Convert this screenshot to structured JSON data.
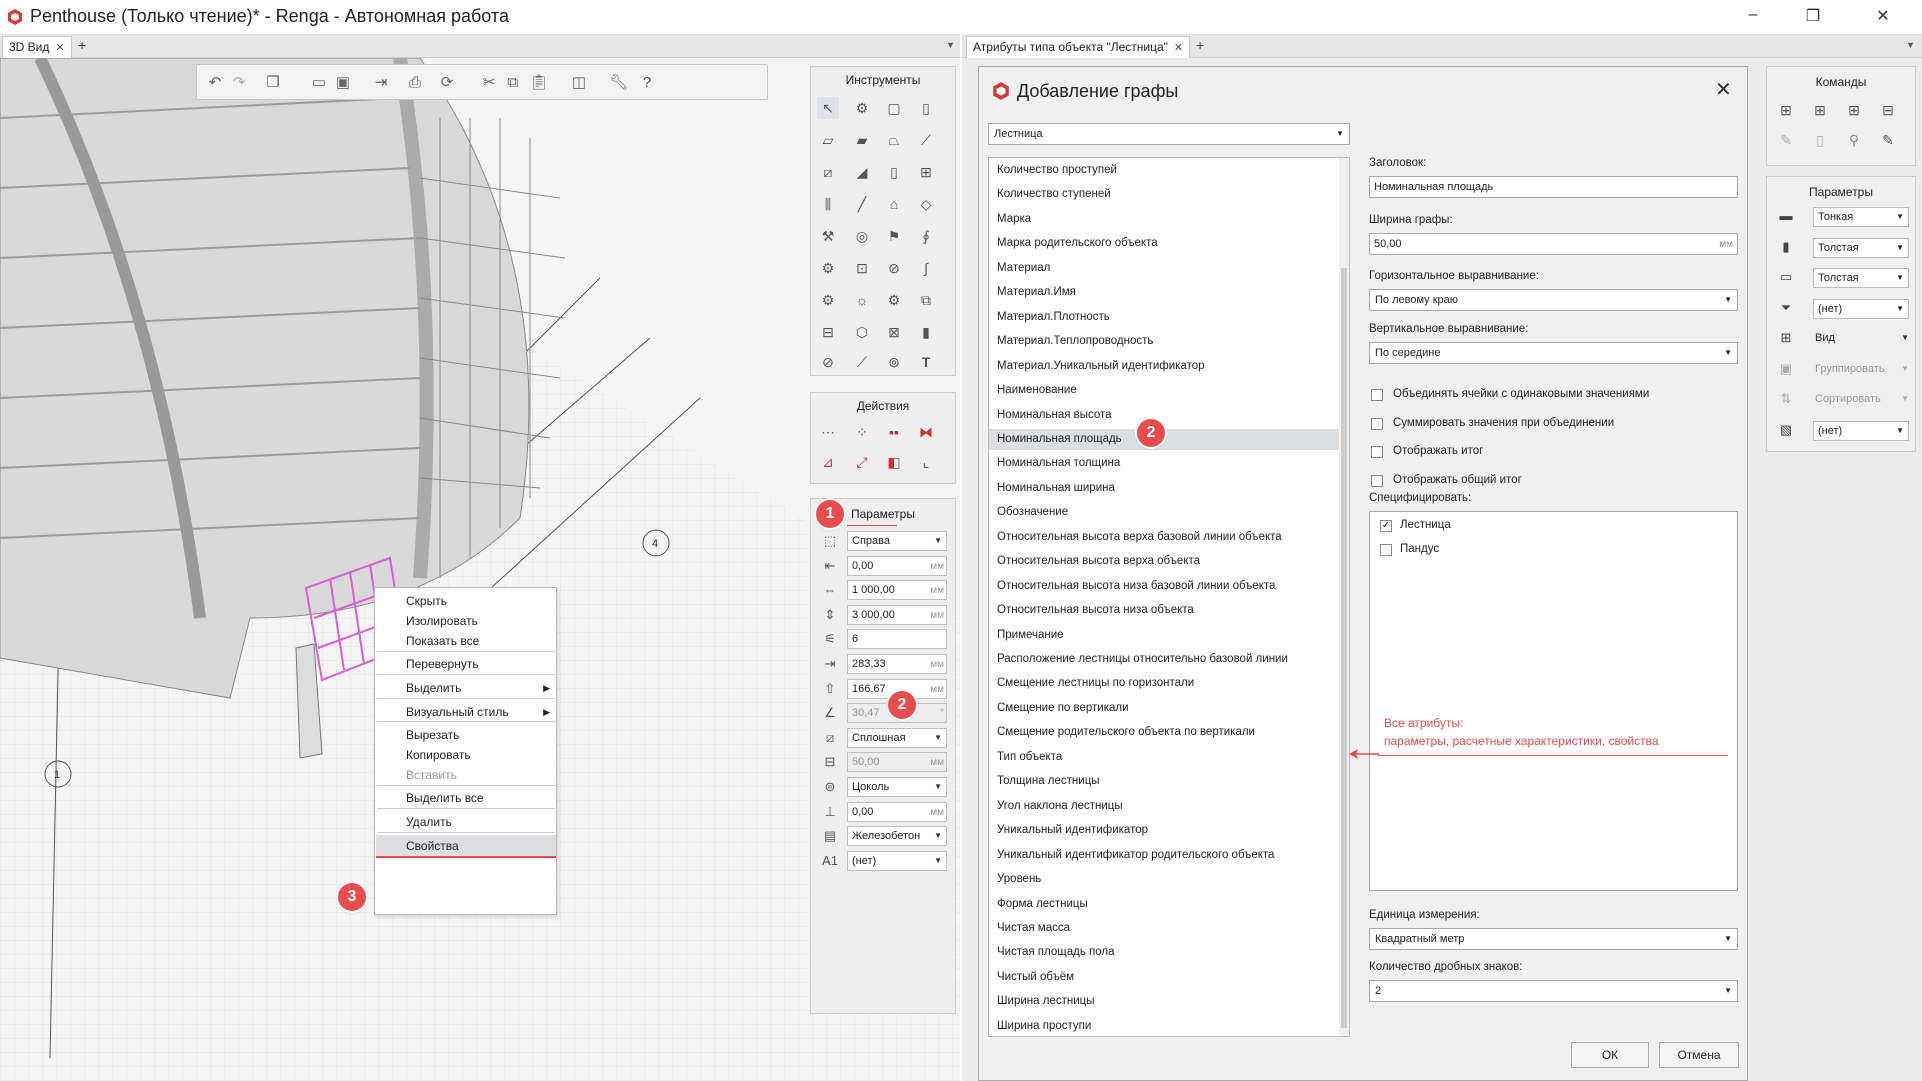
{
  "window": {
    "title": "Penthouse (Только чтение)* - Renga - Автономная работа",
    "controls": [
      "–",
      "❐",
      "✕"
    ]
  },
  "tabs_left": {
    "active": "3D Вид",
    "close": "✕",
    "add": "+",
    "menu": "▼"
  },
  "tabs_right": {
    "active": "Атрибуты типа объекта \"Лестница\"",
    "close": "✕",
    "add": "+",
    "menu": "▼"
  },
  "tools_panel": {
    "title": "Инструменты"
  },
  "actions_panel": {
    "title": "Действия"
  },
  "params_panel": {
    "title": "Параметры",
    "rows": [
      {
        "icon": "cube-icon",
        "value": "Справа",
        "type": "dropdown"
      },
      {
        "icon": "offset-icon",
        "value": "0,00",
        "unit": "мм"
      },
      {
        "icon": "stair-width-icon",
        "value": "1 000,00",
        "unit": "мм"
      },
      {
        "icon": "stair-height-icon",
        "value": "3 000,00",
        "unit": "мм"
      },
      {
        "icon": "steps-count-icon",
        "value": "6"
      },
      {
        "icon": "step-depth-icon",
        "value": "283,33",
        "unit": "мм"
      },
      {
        "icon": "step-height-icon",
        "value": "166,67",
        "unit": "мм"
      },
      {
        "icon": "angle-icon",
        "value": "30,47",
        "unit": "°",
        "disabled": true
      },
      {
        "icon": "stair-type-icon",
        "value": "Сплошная",
        "type": "dropdown"
      },
      {
        "icon": "thickness-icon",
        "value": "50,00",
        "unit": "мм",
        "disabled": true
      },
      {
        "icon": "level-icon",
        "value": "Цоколь",
        "type": "dropdown"
      },
      {
        "icon": "elevation-icon",
        "value": "0,00",
        "unit": "мм"
      },
      {
        "icon": "material-icon",
        "value": "Железобетон",
        "type": "dropdown"
      },
      {
        "icon": "mark-icon",
        "value": "(нет)",
        "type": "dropdown"
      }
    ]
  },
  "context_menu": {
    "items": [
      {
        "label": "Скрыть"
      },
      {
        "label": "Изолировать"
      },
      {
        "label": "Показать все"
      },
      {
        "label": "Перевернуть"
      },
      {
        "label": "Выделить",
        "submenu": true
      },
      {
        "label": "Визуальный стиль",
        "submenu": true
      },
      {
        "label": "Вырезать"
      },
      {
        "label": "Копировать"
      },
      {
        "label": "Вставить",
        "disabled": true
      },
      {
        "label": "Выделить все"
      },
      {
        "label": "Удалить"
      },
      {
        "label": "Свойства",
        "selected": true
      }
    ]
  },
  "badges": {
    "one": "1",
    "two": "2",
    "three": "3"
  },
  "dialog": {
    "title": "Добавление графы",
    "close": "✕",
    "object_select": "Лестница",
    "attributes": [
      "Количество проступей",
      "Количество ступеней",
      "Марка",
      "Марка родительского объекта",
      "Материал",
      "Материал.Имя",
      "Материал.Плотность",
      "Материал.Теплопроводность",
      "Материал.Уникальный идентификатор",
      "Наименование",
      "Номинальная высота",
      "Номинальная площадь",
      "Номинальная толщина",
      "Номинальная ширина",
      "Обозначение",
      "Относительная высота верха базовой линии объекта",
      "Относительная высота верха объекта",
      "Относительная высота низа базовой линии объекта",
      "Относительная высота низа объекта",
      "Примечание",
      "Расположение лестницы относительно базовой линии",
      "Смещение лестницы по горизонтали",
      "Смещение по вертикали",
      "Смещение родительского объекта по вертикали",
      "Тип объекта",
      "Толщина лестницы",
      "Угол наклона лестницы",
      "Уникальный идентификатор",
      "Уникальный идентификатор родительского объекта",
      "Уровень",
      "Форма лестницы",
      "Чистая масса",
      "Чистая площадь пола",
      "Чистый объём",
      "Ширина лестницы",
      "Ширина проступи"
    ],
    "selected_index": 11,
    "header_label": "Заголовок:",
    "header_value": "Номинальная площадь",
    "width_label": "Ширина графы:",
    "width_value": "50,00",
    "width_unit": "мм",
    "halign_label": "Горизонтальное выравнивание:",
    "halign_value": "По левому краю",
    "valign_label": "Вертикальное выравнивание:",
    "valign_value": "По середине",
    "checkboxes": [
      {
        "label": "Объединять ячейки с одинаковыми значениями",
        "checked": false
      },
      {
        "label": "Суммировать значения при объединении",
        "checked": false
      },
      {
        "label": "Отображать итог",
        "checked": false
      },
      {
        "label": "Отображать общий итог",
        "checked": false
      }
    ],
    "specify_label": "Специфицировать:",
    "specify_items": [
      {
        "label": "Лестница",
        "checked": true
      },
      {
        "label": "Пандус",
        "checked": false
      }
    ],
    "annotation": {
      "line1": "Все атрибуты:",
      "line2": "параметры, расчетные характеристики, свойства"
    },
    "unit_label": "Единица измерения:",
    "unit_value": "Квадратный метр",
    "decimals_label": "Количество дробных знаков:",
    "decimals_value": "2",
    "ok": "ОК",
    "cancel": "Отмена"
  },
  "commands_panel": {
    "title": "Команды"
  },
  "right_params_panel": {
    "title": "Параметры",
    "rows": [
      {
        "icon": "line-thin-icon",
        "value": "Тонкая",
        "type": "dropdown"
      },
      {
        "icon": "line-thick-icon",
        "value": "Толстая",
        "type": "dropdown"
      },
      {
        "icon": "border-thick-icon",
        "value": "Толстая",
        "type": "dropdown"
      },
      {
        "icon": "filter-icon",
        "value": "(нет)",
        "type": "dropdown"
      },
      {
        "icon": "view-icon",
        "value": "Вид",
        "type": "menu"
      },
      {
        "icon": "group-icon",
        "value": "Группировать",
        "type": "menu",
        "disabled": true
      },
      {
        "icon": "sort-icon",
        "value": "Сортировать",
        "type": "menu",
        "disabled": true
      },
      {
        "icon": "style-icon",
        "value": "(нет)",
        "type": "dropdown"
      }
    ]
  },
  "colors": {
    "accent_red": "#e84c4c",
    "selection": "#dcdee2",
    "panel": "#efefef"
  }
}
